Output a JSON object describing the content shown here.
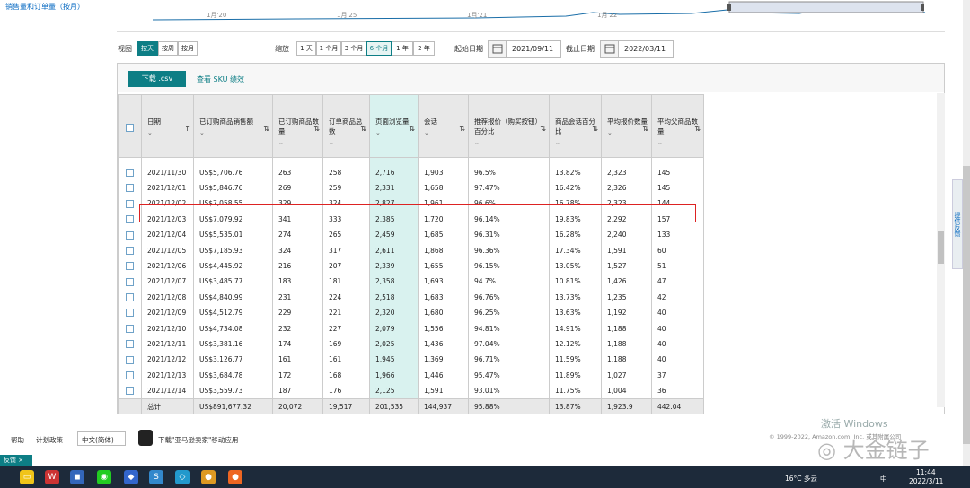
{
  "sidebar": {
    "link": "销售量和订单量（按月）"
  },
  "chart": {
    "ticks": [
      "1月'20",
      "1月'25",
      "1月'21",
      "1月'22"
    ]
  },
  "view": {
    "label": "视图",
    "options": [
      "按天",
      "按周",
      "按月"
    ],
    "selected": "按天"
  },
  "zoom": {
    "label": "缩放",
    "options": [
      "1 天",
      "1 个月",
      "3 个月",
      "6 个月",
      "1 年",
      "2 年"
    ],
    "selected": "6 个月"
  },
  "dates": {
    "start_label": "起始日期",
    "start": "2021/09/11",
    "end_label": "截止日期",
    "end": "2022/03/11"
  },
  "panel": {
    "download": "下载 .csv",
    "sku_link": "查看 SKU 绩效"
  },
  "table": {
    "headers": [
      "日期",
      "已订购商品销售额",
      "已订购商品数量",
      "订单商品总数",
      "页面浏览量",
      "会话",
      "推荐报价（购买按钮）百分比",
      "商品会话百分比",
      "平均报价数量",
      "平均父商品数量"
    ],
    "rows": [
      [
        "2021/11/30",
        "US$5,706.76",
        "263",
        "258",
        "2,716",
        "1,903",
        "96.5%",
        "13.82%",
        "2,323",
        "145"
      ],
      [
        "2021/12/01",
        "US$5,846.76",
        "269",
        "259",
        "2,331",
        "1,658",
        "97.47%",
        "16.42%",
        "2,326",
        "145"
      ],
      [
        "2021/12/02",
        "US$7,058.55",
        "329",
        "324",
        "2,827",
        "1,961",
        "96.6%",
        "16.78%",
        "2,323",
        "144"
      ],
      [
        "2021/12/03",
        "US$7,079.92",
        "341",
        "333",
        "2,385",
        "1,720",
        "96.14%",
        "19.83%",
        "2,292",
        "157"
      ],
      [
        "2021/12/04",
        "US$5,535.01",
        "274",
        "265",
        "2,459",
        "1,685",
        "96.31%",
        "16.28%",
        "2,240",
        "133"
      ],
      [
        "2021/12/05",
        "US$7,185.93",
        "324",
        "317",
        "2,611",
        "1,868",
        "96.36%",
        "17.34%",
        "1,591",
        "60"
      ],
      [
        "2021/12/06",
        "US$4,445.92",
        "216",
        "207",
        "2,339",
        "1,655",
        "96.15%",
        "13.05%",
        "1,527",
        "51"
      ],
      [
        "2021/12/07",
        "US$3,485.77",
        "183",
        "181",
        "2,358",
        "1,693",
        "94.7%",
        "10.81%",
        "1,426",
        "47"
      ],
      [
        "2021/12/08",
        "US$4,840.99",
        "231",
        "224",
        "2,518",
        "1,683",
        "96.76%",
        "13.73%",
        "1,235",
        "42"
      ],
      [
        "2021/12/09",
        "US$4,512.79",
        "229",
        "221",
        "2,320",
        "1,680",
        "96.25%",
        "13.63%",
        "1,192",
        "40"
      ],
      [
        "2021/12/10",
        "US$4,734.08",
        "232",
        "227",
        "2,079",
        "1,556",
        "94.81%",
        "14.91%",
        "1,188",
        "40"
      ],
      [
        "2021/12/11",
        "US$3,381.16",
        "174",
        "169",
        "2,025",
        "1,436",
        "97.04%",
        "12.12%",
        "1,188",
        "40"
      ],
      [
        "2021/12/12",
        "US$3,126.77",
        "161",
        "161",
        "1,945",
        "1,369",
        "96.71%",
        "11.59%",
        "1,188",
        "40"
      ],
      [
        "2021/12/13",
        "US$3,684.78",
        "172",
        "168",
        "1,966",
        "1,446",
        "95.47%",
        "11.89%",
        "1,027",
        "37"
      ],
      [
        "2021/12/14",
        "US$3,559.73",
        "187",
        "176",
        "2,125",
        "1,591",
        "93.01%",
        "11.75%",
        "1,004",
        "36"
      ]
    ],
    "total": [
      "总计",
      "US$891,677.32",
      "20,072",
      "19,517",
      "201,535",
      "144,937",
      "95.88%",
      "13.87%",
      "1,923.9",
      "442.04"
    ]
  },
  "feedback": "提供反馈",
  "footer": {
    "help": "帮助",
    "policy": "计划政策",
    "lang": "中文(简体)",
    "app": "下载\"亚马逊卖家\"移动应用",
    "copyright": "© 1999-2022, Amazon.com, Inc. 或其附属公司"
  },
  "tab": "反馈",
  "watermark": {
    "activate": "激活 Windows",
    "brand": "大金链子"
  },
  "taskbar": {
    "weather": "16°C 多云",
    "ime": "中",
    "time": "11:44",
    "date": "2022/3/11"
  }
}
